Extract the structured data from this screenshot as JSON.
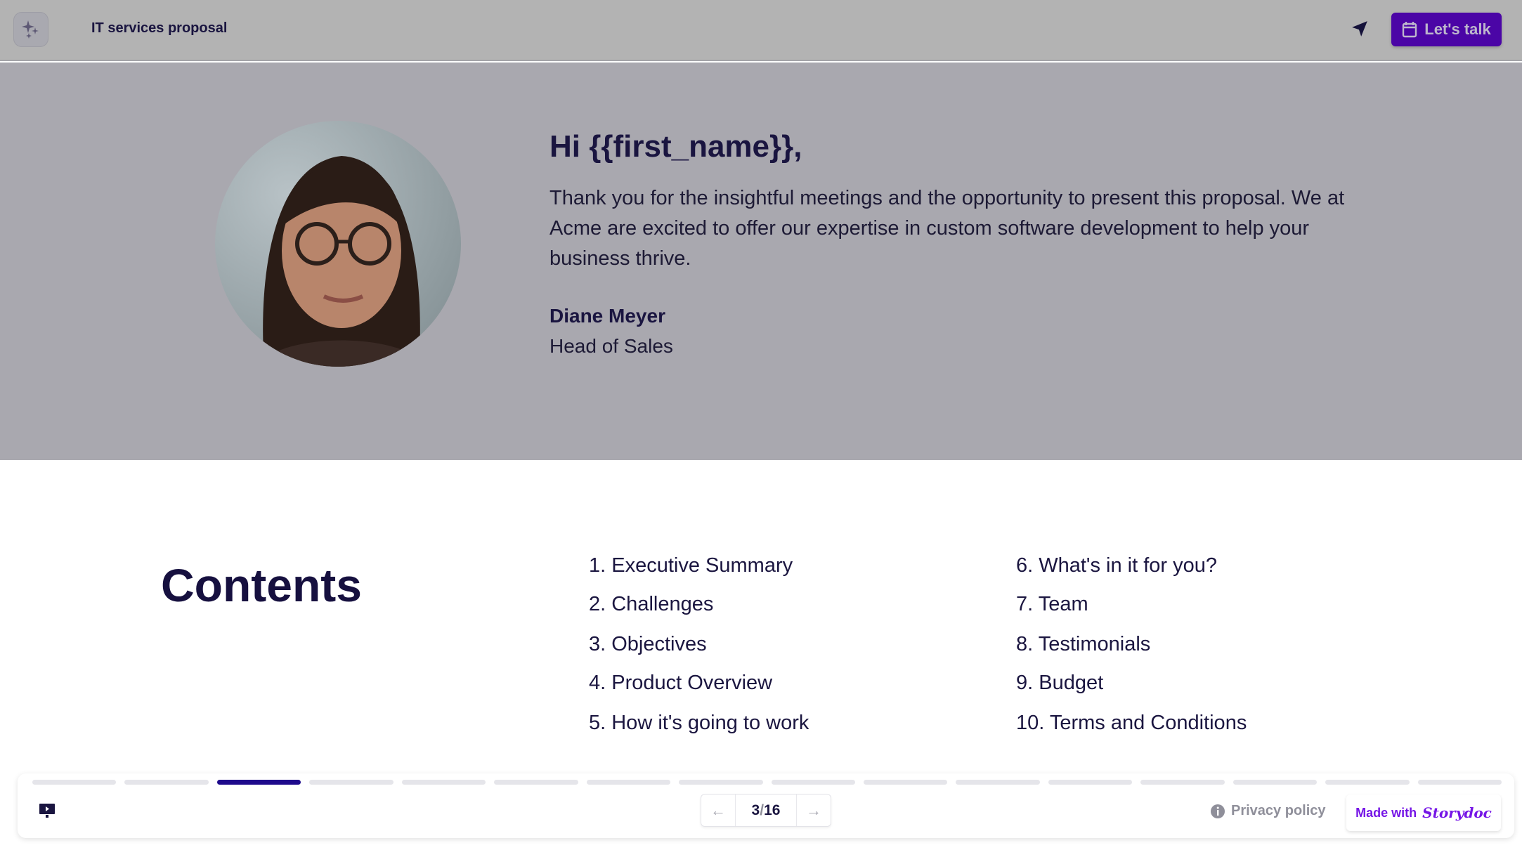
{
  "header": {
    "title": "IT services proposal",
    "cta_label": "Let's talk",
    "logo_icon": "sparkles-icon",
    "send_icon": "paper-plane-icon",
    "cta_icon": "calendar-icon",
    "accent": "#4b05a6"
  },
  "hero": {
    "greeting": "Hi {{first_name}},",
    "message": "Thank you for the insightful meetings and the opportunity to present this proposal. We at Acme are excited to offer our expertise in custom software development to help your business thrive.",
    "sender_name": "Diane Meyer",
    "sender_role": "Head of Sales"
  },
  "contents": {
    "heading": "Contents",
    "items": [
      "1. Executive Summary",
      "2. Challenges",
      "3. Objectives",
      "4. Product Overview",
      "5. How it's going to work",
      "6. What's in it for you?",
      "7. Team",
      "8. Testimonials",
      "9. Budget",
      "10. Terms and Conditions"
    ]
  },
  "footer": {
    "current_page": "3",
    "total_pages": "16",
    "page_separator": "/",
    "privacy_label": "Privacy policy",
    "made_with": "Made with",
    "brand": "Storydoc",
    "progress_segments": 16,
    "active_segment": 3,
    "active_color": "#1e0a8c"
  }
}
